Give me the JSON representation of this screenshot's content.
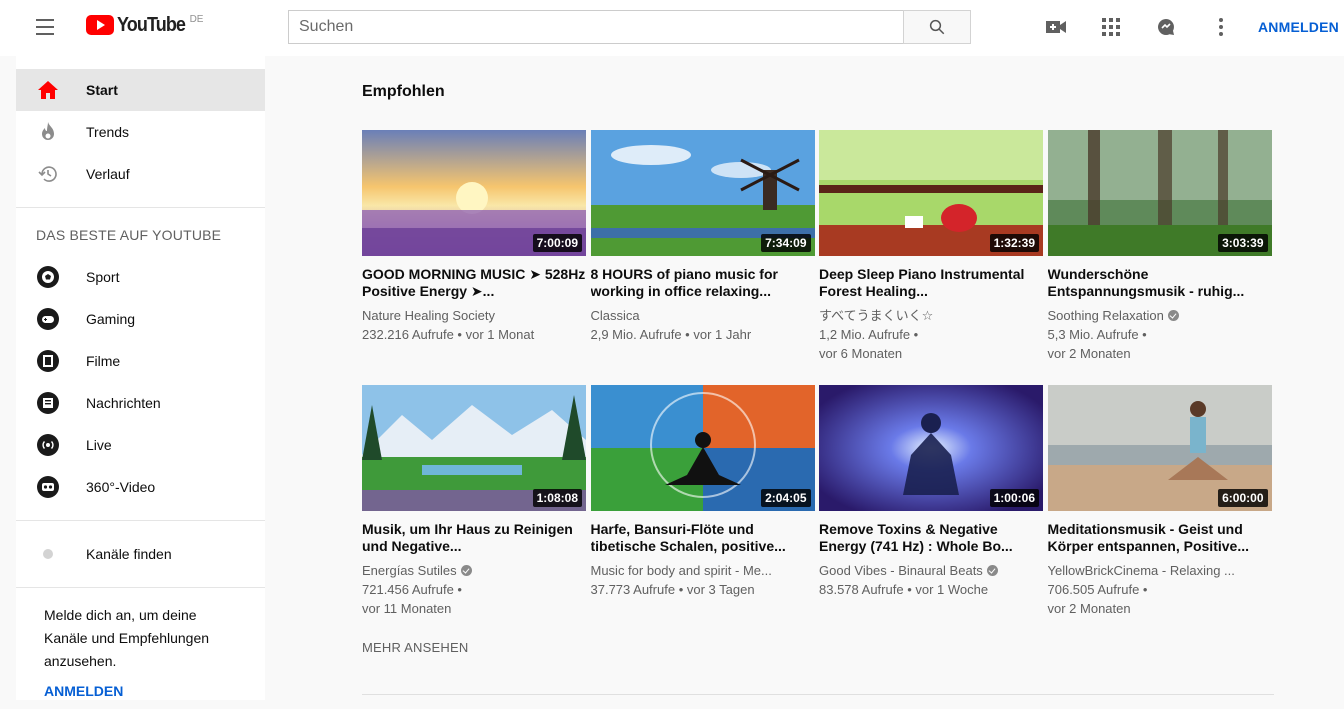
{
  "header": {
    "logo_text": "YouTube",
    "country": "DE",
    "search_placeholder": "Suchen",
    "signin": "ANMELDEN",
    "icons": [
      "create-video-icon",
      "apps-icon",
      "messages-icon",
      "more-icon"
    ]
  },
  "sidebar": {
    "primary": [
      {
        "label": "Start",
        "icon": "home-icon",
        "active": true
      },
      {
        "label": "Trends",
        "icon": "trending-icon"
      },
      {
        "label": "Verlauf",
        "icon": "history-icon"
      }
    ],
    "best_heading": "DAS BESTE AUF YOUTUBE",
    "best": [
      {
        "label": "Sport",
        "icon": "sport-icon"
      },
      {
        "label": "Gaming",
        "icon": "gaming-icon"
      },
      {
        "label": "Filme",
        "icon": "movies-icon"
      },
      {
        "label": "Nachrichten",
        "icon": "news-icon"
      },
      {
        "label": "Live",
        "icon": "live-icon"
      },
      {
        "label": "360°-Video",
        "icon": "360-video-icon"
      }
    ],
    "browse_channels": "Kanäle finden",
    "signin_prompt": "Melde dich an, um deine Kanäle und Empfehlungen anzusehen.",
    "signin_link": "ANMELDEN"
  },
  "main": {
    "section_title": "Empfohlen",
    "more_label": "MEHR ANSEHEN",
    "videos": [
      {
        "title": "GOOD MORNING MUSIC ➤ 528Hz Positive Energy ➤...",
        "channel": "Nature Healing Society",
        "verified": false,
        "views": "232.216 Aufrufe",
        "age": "vor 1 Monat",
        "duration": "7:00:09"
      },
      {
        "title": "8 HOURS of piano music for working in office relaxing...",
        "channel": "Classica",
        "verified": false,
        "views": "2,9 Mio. Aufrufe",
        "age": "vor 1 Jahr",
        "duration": "7:34:09"
      },
      {
        "title": "Deep Sleep Piano Instrumental Forest Healing...",
        "channel": "すべてうまくいく☆",
        "verified": false,
        "views": "1,2 Mio. Aufrufe",
        "age": "vor 6 Monaten",
        "duration": "1:32:39"
      },
      {
        "title": "Wunderschöne Entspannungsmusik - ruhig...",
        "channel": "Soothing Relaxation",
        "verified": true,
        "views": "5,3 Mio. Aufrufe",
        "age": "vor 2 Monaten",
        "duration": "3:03:39"
      },
      {
        "title": "Musik, um Ihr Haus zu Reinigen und Negative...",
        "channel": "Energías Sutiles",
        "verified": true,
        "views": "721.456 Aufrufe",
        "age": "vor 11 Monaten",
        "duration": "1:08:08"
      },
      {
        "title": "Harfe, Bansuri-Flöte und tibetische Schalen, positive...",
        "channel": "Music for body and spirit - Me...",
        "verified": false,
        "views": "37.773 Aufrufe",
        "age": "vor 3 Tagen",
        "duration": "2:04:05"
      },
      {
        "title": "Remove Toxins & Negative Energy (741 Hz) : Whole Bo...",
        "channel": "Good Vibes - Binaural Beats",
        "verified": true,
        "views": "83.578 Aufrufe",
        "age": "vor 1 Woche",
        "duration": "1:00:06"
      },
      {
        "title": "Meditationsmusik - Geist und Körper entspannen, Positive...",
        "channel": "YellowBrickCinema - Relaxing ...",
        "verified": false,
        "views": "706.505 Aufrufe",
        "age": "vor 2 Monaten",
        "duration": "6:00:00"
      }
    ]
  }
}
